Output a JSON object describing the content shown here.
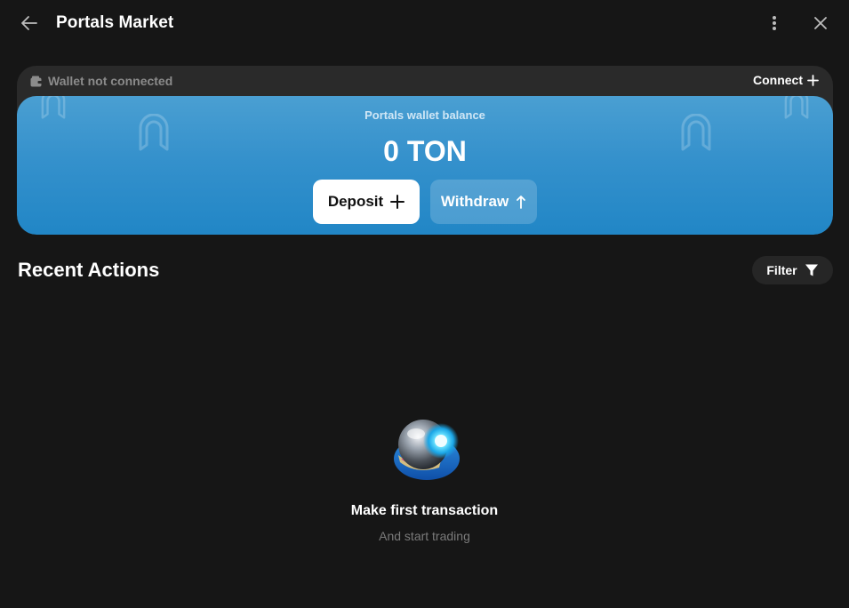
{
  "header": {
    "title": "Portals Market",
    "back_icon": "arrow-left-icon",
    "more_icon": "more-vertical-icon",
    "close_icon": "close-icon"
  },
  "wallet": {
    "status_text": "Wallet not connected",
    "status_icon": "wallet-icon",
    "connect_label": "Connect",
    "connect_icon": "plus-icon",
    "balance_label": "Portals wallet balance",
    "balance_value": "0 TON",
    "deposit_label": "Deposit",
    "deposit_icon": "plus-icon",
    "withdraw_label": "Withdraw",
    "withdraw_icon": "arrow-up-icon",
    "watermark_icon": "portals-logo-icon"
  },
  "recent_actions": {
    "title": "Recent Actions",
    "filter_label": "Filter",
    "filter_icon": "funnel-icon"
  },
  "empty_state": {
    "illustration": "orb-illustration-icon",
    "title": "Make first transaction",
    "subtitle": "And start trading"
  },
  "colors": {
    "background": "#161616",
    "card_bar": "#2a2a2a",
    "balance_top": "#4a9fd2",
    "balance_bottom": "#2186c6",
    "muted_text": "#7a7a7a"
  }
}
